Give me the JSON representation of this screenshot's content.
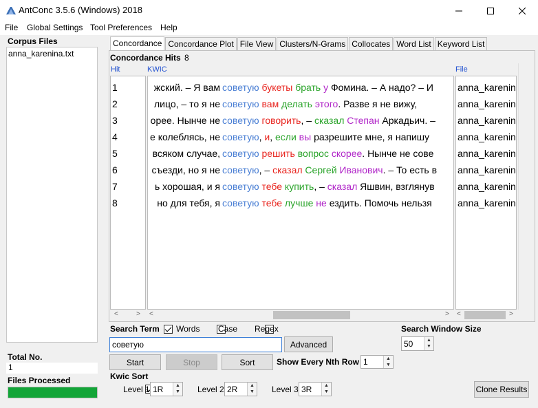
{
  "window": {
    "title": "AntConc 3.5.6 (Windows) 2018"
  },
  "menu": [
    "File",
    "Global Settings",
    "Tool Preferences",
    "Help"
  ],
  "left": {
    "corpus_files_label": "Corpus Files",
    "files": [
      "anna_karenina.txt"
    ],
    "total_no_label": "Total No.",
    "total_no": "1",
    "files_processed_label": "Files Processed",
    "progress": 1.0
  },
  "tabs": [
    "Concordance",
    "Concordance Plot",
    "File View",
    "Clusters/N-Grams",
    "Collocates",
    "Word List",
    "Keyword List"
  ],
  "hits": {
    "label": "Concordance Hits",
    "count": "8"
  },
  "columns": {
    "hit": "Hit",
    "kwic": "KWIC",
    "file": "File"
  },
  "rows": [
    {
      "n": "1",
      "left": "жский. – Я вам ",
      "kw": "советую",
      "right": [
        {
          "t": " букеты",
          "c": "red"
        },
        {
          "t": " брать",
          "c": "green"
        },
        {
          "t": " у",
          "c": "purple"
        },
        {
          "t": " Фомина.  – А надо? – И",
          "c": "black"
        }
      ],
      "file": "anna_karenina"
    },
    {
      "n": "2",
      "left": "лицо, – то я не ",
      "kw": "советую",
      "right": [
        {
          "t": " вам",
          "c": "red"
        },
        {
          "t": " делать",
          "c": "green"
        },
        {
          "t": " этого",
          "c": "purple"
        },
        {
          "t": ". Разве я не вижу,",
          "c": "black"
        }
      ],
      "file": "anna_karenina"
    },
    {
      "n": "3",
      "left": "орее. Нынче не ",
      "kw": "советую",
      "right": [
        {
          "t": " говорить",
          "c": "red"
        },
        {
          "t": ", –",
          "c": "black"
        },
        {
          "t": " сказал",
          "c": "green"
        },
        {
          "t": " Степан",
          "c": "purple"
        },
        {
          "t": " Аркадьич. –",
          "c": "black"
        }
      ],
      "file": "anna_karenina"
    },
    {
      "n": "4",
      "left": "е колеблясь, не ",
      "kw": "советую",
      "right": [
        {
          "t": ",",
          "c": "black"
        },
        {
          "t": " и",
          "c": "red"
        },
        {
          "t": ",",
          "c": "black"
        },
        {
          "t": " если",
          "c": "green"
        },
        {
          "t": " вы",
          "c": "purple"
        },
        {
          "t": " разрешите мне, я напишу",
          "c": "black"
        }
      ],
      "file": "anna_karenina"
    },
    {
      "n": "5",
      "left": "всяком случае, ",
      "kw": "советую",
      "right": [
        {
          "t": " решить",
          "c": "red"
        },
        {
          "t": " вопрос",
          "c": "green"
        },
        {
          "t": " скорее",
          "c": "purple"
        },
        {
          "t": ". Нынче не сове",
          "c": "black"
        }
      ],
      "file": "anna_karenina"
    },
    {
      "n": "6",
      "left": "съезди, но я не ",
      "kw": "советую",
      "right": [
        {
          "t": ", –",
          "c": "black"
        },
        {
          "t": " сказал",
          "c": "red"
        },
        {
          "t": " Сергей",
          "c": "green"
        },
        {
          "t": " Иванович",
          "c": "purple"
        },
        {
          "t": ". – То есть в",
          "c": "black"
        }
      ],
      "file": "anna_karenina"
    },
    {
      "n": "7",
      "left": "ь хорошая, и я ",
      "kw": "советую",
      "right": [
        {
          "t": " тебе",
          "c": "red"
        },
        {
          "t": " купить",
          "c": "green"
        },
        {
          "t": ", –",
          "c": "black"
        },
        {
          "t": " сказал",
          "c": "purple"
        },
        {
          "t": " Яшвин, взглянув",
          "c": "black"
        }
      ],
      "file": "anna_karenina"
    },
    {
      "n": "8",
      "left": " но для тебя, я ",
      "kw": "советую",
      "right": [
        {
          "t": " тебе",
          "c": "red"
        },
        {
          "t": " лучше",
          "c": "green"
        },
        {
          "t": " не",
          "c": "purple"
        },
        {
          "t": " ездить. Помочь нельзя",
          "c": "black"
        }
      ],
      "file": "anna_karenina"
    }
  ],
  "colors": {
    "kw": "#4a7fd4",
    "red": "#e8251f",
    "green": "#29a329",
    "purple": "#b025c8",
    "black": "#000000",
    "progress": "#13a538"
  },
  "search": {
    "term_label": "Search Term",
    "words_label": "Words",
    "case_label": "Case",
    "regex_label": "Regex",
    "words_checked": true,
    "case_checked": false,
    "regex_checked": false,
    "value": "советую",
    "advanced_label": "Advanced",
    "window_size_label": "Search Window Size",
    "window_size": "50"
  },
  "buttons": {
    "start": "Start",
    "stop": "Stop",
    "sort": "Sort",
    "clone": "Clone Results"
  },
  "nth": {
    "label": "Show Every Nth Row",
    "value": "1"
  },
  "kwic_sort": {
    "label": "Kwic Sort",
    "levels": [
      {
        "label": "Level 1",
        "value": "1R"
      },
      {
        "label": "Level 2",
        "value": "2R"
      },
      {
        "label": "Level 3",
        "value": "3R"
      }
    ]
  }
}
